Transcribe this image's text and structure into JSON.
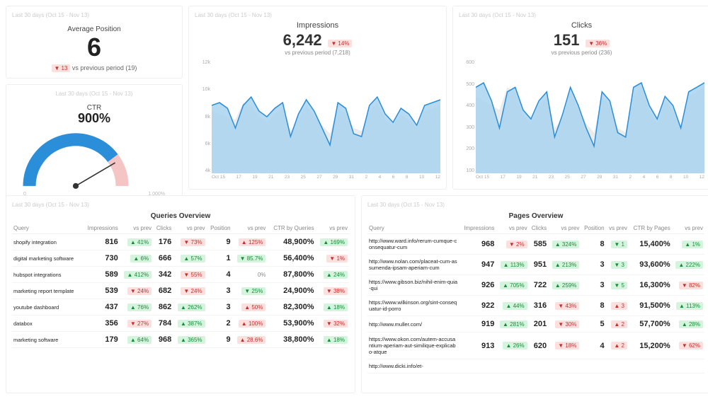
{
  "period": "Last 30 days (Oct 15 - Nov 13)",
  "kpi_position": {
    "title": "Average Position",
    "value": "6",
    "delta": "13",
    "dir": "down",
    "sub": "vs previous period (19)"
  },
  "kpi_ctr": {
    "title": "CTR",
    "value": "900%",
    "min": "0",
    "max": "1,000%"
  },
  "chart_data": [
    {
      "type": "line",
      "title": "Impressions",
      "value": "6,242",
      "delta": "14%",
      "dir": "down",
      "sub": "vs previous period (7,218)",
      "yticks": [
        "12k",
        "10k",
        "8k",
        "6k",
        "4k"
      ],
      "ylim": [
        4000,
        12000
      ],
      "xticks": [
        "Oct 15",
        "17",
        "19",
        "21",
        "23",
        "25",
        "27",
        "29",
        "31",
        "2",
        "4",
        "6",
        "8",
        "10",
        "12"
      ],
      "series": [
        {
          "name": "current",
          "values": [
            8800,
            9000,
            8600,
            7200,
            8800,
            9400,
            8400,
            8000,
            8600,
            9000,
            6600,
            8200,
            9200,
            8400,
            7200,
            6000,
            9000,
            8600,
            6800,
            6600,
            8800,
            9400,
            8200,
            7600,
            8600,
            8200,
            7400,
            8800,
            9000,
            9200
          ]
        },
        {
          "name": "previous",
          "values": [
            8400,
            8200,
            8000,
            7800,
            9000,
            8800,
            8000,
            7600,
            8200,
            8600,
            7000,
            7800,
            8800,
            8000,
            7400,
            6800,
            8600,
            8200,
            7200,
            7000,
            8400,
            9000,
            7800,
            7400,
            8200,
            7800,
            7200,
            8400,
            8600,
            8800
          ]
        }
      ]
    },
    {
      "type": "line",
      "title": "Clicks",
      "value": "151",
      "delta": "36%",
      "dir": "down",
      "sub": "vs previous period (236)",
      "yticks": [
        "600",
        "500",
        "400",
        "300",
        "200",
        "100"
      ],
      "ylim": [
        100,
        600
      ],
      "xticks": [
        "Oct 15",
        "17",
        "19",
        "21",
        "23",
        "25",
        "27",
        "29",
        "31",
        "2",
        "4",
        "6",
        "8",
        "10",
        "12"
      ],
      "series": [
        {
          "name": "current",
          "values": [
            480,
            500,
            420,
            300,
            460,
            480,
            380,
            340,
            420,
            460,
            260,
            360,
            480,
            400,
            300,
            220,
            460,
            420,
            280,
            260,
            480,
            500,
            400,
            340,
            440,
            400,
            300,
            460,
            480,
            500
          ]
        },
        {
          "name": "previous",
          "values": [
            440,
            420,
            400,
            380,
            480,
            460,
            360,
            320,
            400,
            440,
            300,
            340,
            460,
            380,
            320,
            280,
            440,
            400,
            300,
            280,
            440,
            480,
            380,
            320,
            420,
            380,
            300,
            440,
            460,
            480
          ]
        }
      ]
    }
  ],
  "queries": {
    "title": "Queries Overview",
    "headers": [
      "Query",
      "Impressions",
      "vs prev",
      "Clicks",
      "vs prev",
      "Position",
      "vs prev",
      "CTR by Queries",
      "vs prev"
    ],
    "rows": [
      {
        "q": "shopify integration",
        "imp": "816",
        "imp_d": "41%",
        "imp_dir": "up",
        "clk": "176",
        "clk_d": "73%",
        "clk_dir": "down",
        "pos": "9",
        "pos_d": "125%",
        "pos_dir": "up-red",
        "ctr": "48,900%",
        "ctr_d": "169%",
        "ctr_dir": "up"
      },
      {
        "q": "digital marketing software",
        "imp": "730",
        "imp_d": "6%",
        "imp_dir": "up",
        "clk": "666",
        "clk_d": "57%",
        "clk_dir": "up",
        "pos": "1",
        "pos_d": "85.7%",
        "pos_dir": "down-green",
        "ctr": "56,400%",
        "ctr_d": "1%",
        "ctr_dir": "down"
      },
      {
        "q": "hubspot integrations",
        "imp": "589",
        "imp_d": "412%",
        "imp_dir": "up",
        "clk": "342",
        "clk_d": "55%",
        "clk_dir": "down",
        "pos": "4",
        "pos_d": "0%",
        "pos_dir": "flat",
        "ctr": "87,800%",
        "ctr_d": "24%",
        "ctr_dir": "up"
      },
      {
        "q": "marketing report template",
        "imp": "539",
        "imp_d": "24%",
        "imp_dir": "down",
        "clk": "682",
        "clk_d": "24%",
        "clk_dir": "down",
        "pos": "3",
        "pos_d": "25%",
        "pos_dir": "down-green",
        "ctr": "24,900%",
        "ctr_d": "38%",
        "ctr_dir": "down"
      },
      {
        "q": "youtube dashboard",
        "imp": "437",
        "imp_d": "76%",
        "imp_dir": "up",
        "clk": "862",
        "clk_d": "262%",
        "clk_dir": "up",
        "pos": "3",
        "pos_d": "50%",
        "pos_dir": "up-red",
        "ctr": "82,300%",
        "ctr_d": "18%",
        "ctr_dir": "up"
      },
      {
        "q": "databox",
        "imp": "356",
        "imp_d": "27%",
        "imp_dir": "down",
        "clk": "784",
        "clk_d": "387%",
        "clk_dir": "up",
        "pos": "2",
        "pos_d": "100%",
        "pos_dir": "up-red",
        "ctr": "53,900%",
        "ctr_d": "32%",
        "ctr_dir": "down"
      },
      {
        "q": "marketing software",
        "imp": "179",
        "imp_d": "64%",
        "imp_dir": "up",
        "clk": "968",
        "clk_d": "365%",
        "clk_dir": "up",
        "pos": "9",
        "pos_d": "28.6%",
        "pos_dir": "up-red",
        "ctr": "38,800%",
        "ctr_d": "18%",
        "ctr_dir": "up"
      }
    ]
  },
  "pages": {
    "title": "Pages Overview",
    "headers": [
      "Query",
      "Impressions",
      "vs prev",
      "Clicks",
      "vs prev",
      "Position",
      "vs prev",
      "CTR by Pages",
      "vs prev"
    ],
    "rows": [
      {
        "q": "http://www.ward.info/rerum-cumque-consequatur-cum",
        "imp": "968",
        "imp_d": "2%",
        "imp_dir": "down",
        "clk": "585",
        "clk_d": "324%",
        "clk_dir": "up",
        "pos": "8",
        "pos_d": "1",
        "pos_dir": "down-green",
        "ctr": "15,400%",
        "ctr_d": "1%",
        "ctr_dir": "up"
      },
      {
        "q": "http://www.nolan.com/placeat-cum-assumenda-ipsam-aperiam-cum",
        "imp": "947",
        "imp_d": "113%",
        "imp_dir": "up",
        "clk": "951",
        "clk_d": "213%",
        "clk_dir": "up",
        "pos": "3",
        "pos_d": "3",
        "pos_dir": "down-green",
        "ctr": "93,600%",
        "ctr_d": "222%",
        "ctr_dir": "up"
      },
      {
        "q": "https://www.gibson.biz/nihil-enim-quia-qui",
        "imp": "926",
        "imp_d": "705%",
        "imp_dir": "up",
        "clk": "722",
        "clk_d": "259%",
        "clk_dir": "up",
        "pos": "3",
        "pos_d": "5",
        "pos_dir": "down-green",
        "ctr": "16,300%",
        "ctr_d": "82%",
        "ctr_dir": "down"
      },
      {
        "q": "https://www.wilkinson.org/sint-consequatur-id-porro",
        "imp": "922",
        "imp_d": "44%",
        "imp_dir": "up",
        "clk": "316",
        "clk_d": "43%",
        "clk_dir": "down",
        "pos": "8",
        "pos_d": "3",
        "pos_dir": "up-red",
        "ctr": "91,500%",
        "ctr_d": "113%",
        "ctr_dir": "up"
      },
      {
        "q": "http://www.muller.com/",
        "imp": "919",
        "imp_d": "281%",
        "imp_dir": "up",
        "clk": "201",
        "clk_d": "30%",
        "clk_dir": "down",
        "pos": "5",
        "pos_d": "2",
        "pos_dir": "up-red",
        "ctr": "57,700%",
        "ctr_d": "28%",
        "ctr_dir": "up"
      },
      {
        "q": "https://www.okon.com/autem-accusantium-aperiam-aut-similique-explicabo-atque",
        "imp": "913",
        "imp_d": "26%",
        "imp_dir": "up",
        "clk": "620",
        "clk_d": "18%",
        "clk_dir": "down",
        "pos": "4",
        "pos_d": "2",
        "pos_dir": "up-red",
        "ctr": "15,200%",
        "ctr_d": "62%",
        "ctr_dir": "down"
      },
      {
        "q": "http://www.dicki.info/et-",
        "imp": "",
        "imp_d": "",
        "imp_dir": "",
        "clk": "",
        "clk_d": "",
        "clk_dir": "",
        "pos": "",
        "pos_d": "",
        "pos_dir": "",
        "ctr": "",
        "ctr_d": "",
        "ctr_dir": ""
      }
    ]
  }
}
